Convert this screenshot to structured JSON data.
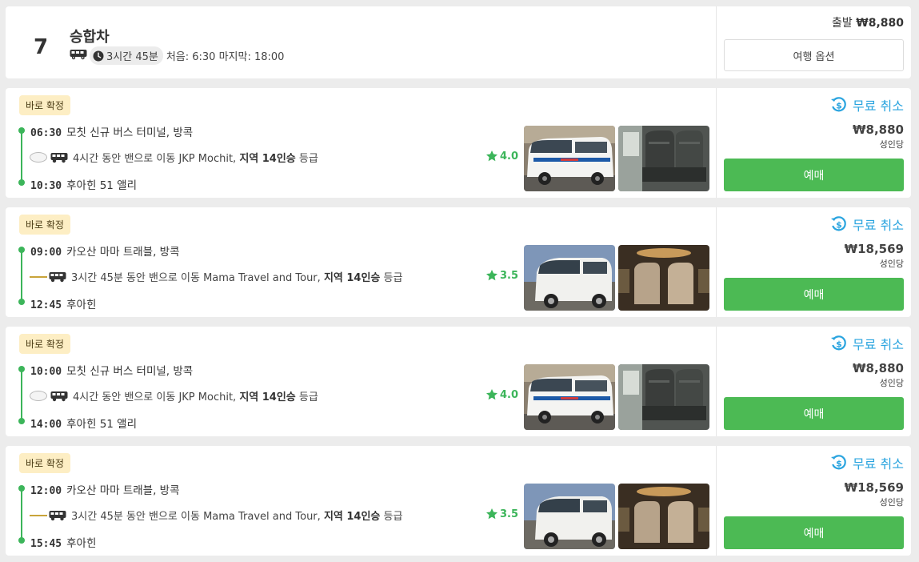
{
  "header": {
    "number": "7",
    "title": "승합차",
    "duration": "3시간 45분",
    "schedule": "처음: 6:30 마지막: 18:00",
    "price_prefix": "출발",
    "price": "₩8,880",
    "options_label": "여행 옵션"
  },
  "trips": [
    {
      "badge": "바로 확정",
      "depart_time": "06:30",
      "depart_place": "모칫 신규 버스 터미널, 방콕",
      "trip_text": "4시간 동안 밴으로 이동 JKP Mochit,",
      "class_label": "지역 14인승",
      "class_suffix": "등급",
      "rating": "4.0",
      "arrive_time": "10:30",
      "arrive_place": "후아힌 51 앨리",
      "cancel": "무료 취소",
      "price": "₩8,880",
      "per": "성인당",
      "book": "예매"
    },
    {
      "badge": "바로 확정",
      "depart_time": "09:00",
      "depart_place": "카오산 마마 트래블, 방콕",
      "trip_text": "3시간 45분 동안 밴으로 이동 Mama Travel and Tour,",
      "class_label": "지역 14인승",
      "class_suffix": "등급",
      "rating": "3.5",
      "arrive_time": "12:45",
      "arrive_place": "후아힌",
      "cancel": "무료 취소",
      "price": "₩18,569",
      "per": "성인당",
      "book": "예매"
    },
    {
      "badge": "바로 확정",
      "depart_time": "10:00",
      "depart_place": "모칫 신규 버스 터미널, 방콕",
      "trip_text": "4시간 동안 밴으로 이동 JKP Mochit,",
      "class_label": "지역 14인승",
      "class_suffix": "등급",
      "rating": "4.0",
      "arrive_time": "14:00",
      "arrive_place": "후아힌 51 앨리",
      "cancel": "무료 취소",
      "price": "₩8,880",
      "per": "성인당",
      "book": "예매"
    },
    {
      "badge": "바로 확정",
      "depart_time": "12:00",
      "depart_place": "카오산 마마 트래블, 방콕",
      "trip_text": "3시간 45분 동안 밴으로 이동 Mama Travel and Tour,",
      "class_label": "지역 14인승",
      "class_suffix": "등급",
      "rating": "3.5",
      "arrive_time": "15:45",
      "arrive_place": "후아힌",
      "cancel": "무료 취소",
      "price": "₩18,569",
      "per": "성인당",
      "book": "예매"
    }
  ],
  "colors": {
    "accent_green": "#4cba54",
    "cancel_blue": "#2aa4df",
    "badge_bg": "#fdeec4"
  },
  "icons": [
    "van-icon",
    "clock-icon",
    "star-icon",
    "refund-icon",
    "operator-logo-icon"
  ]
}
